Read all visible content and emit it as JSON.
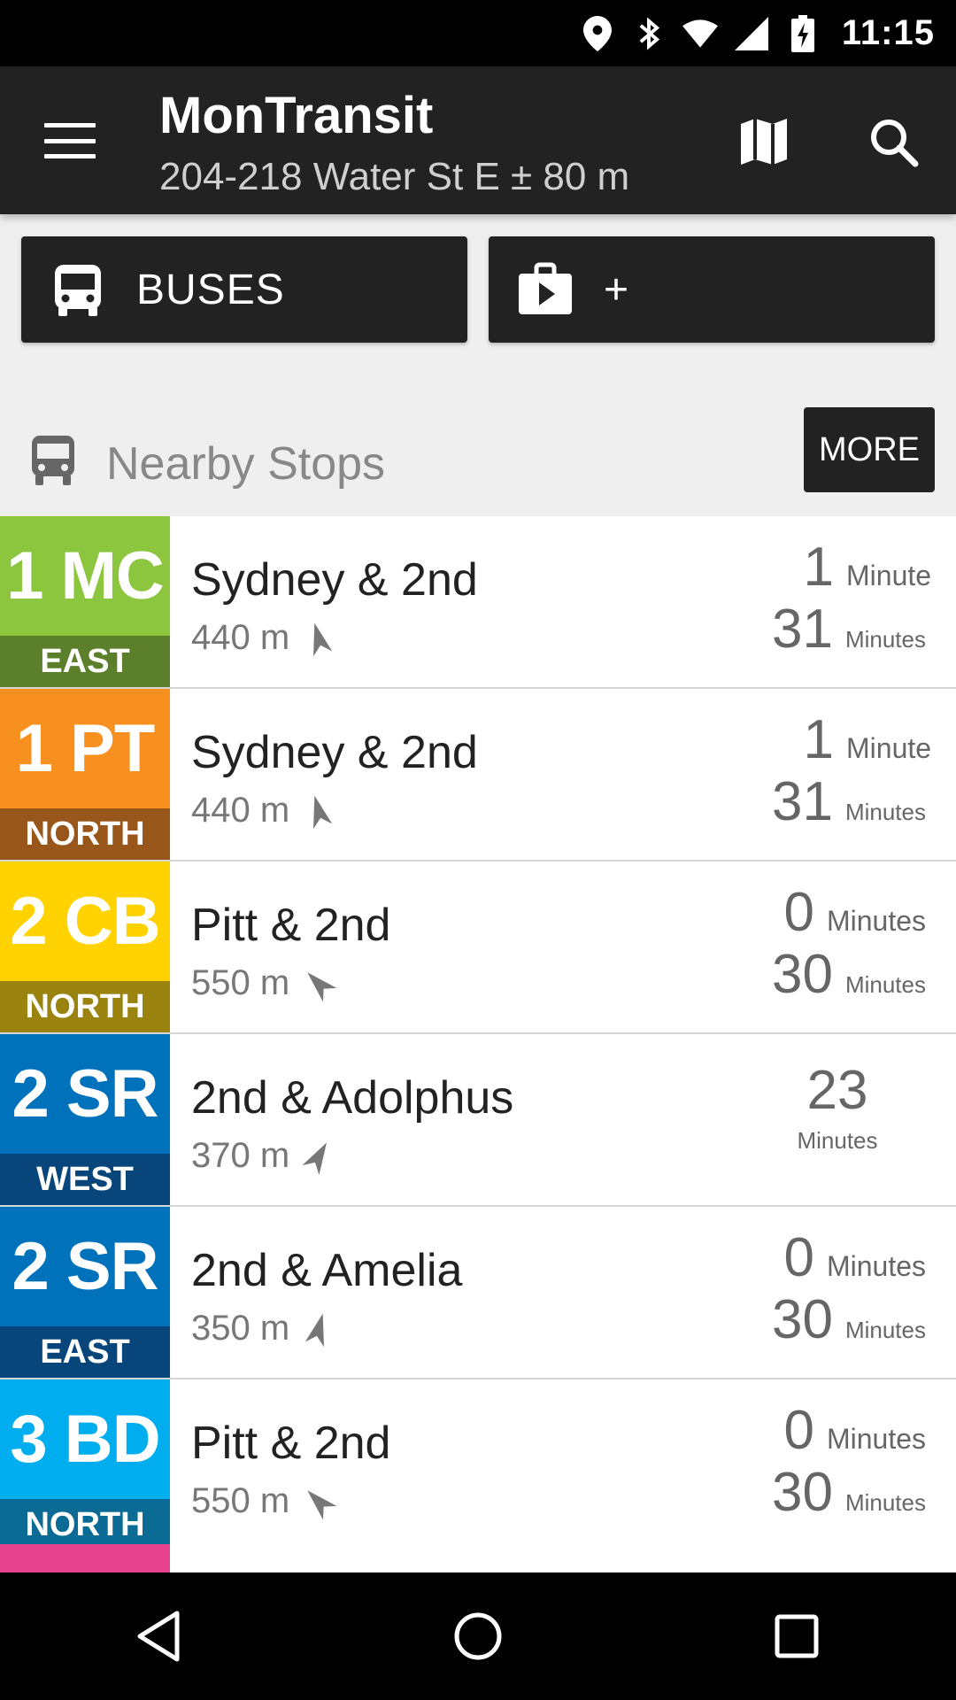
{
  "status": {
    "time": "11:15"
  },
  "appbar": {
    "title": "MonTransit",
    "subtitle": "204-218 Water St E ± 80 m"
  },
  "agencies": [
    {
      "label": "BUSES",
      "icon": "bus-icon"
    },
    {
      "label": "+",
      "icon": "store-icon"
    }
  ],
  "section": {
    "title": "Nearby Stops",
    "more_label": "MORE",
    "icon": "bus-icon"
  },
  "stops": [
    {
      "route": "1 MC",
      "direction": "EAST",
      "name": "Sydney & 2nd",
      "distance": "440 m",
      "color": "#8cc63f",
      "dir_color": "#5b7f2a",
      "time1": "1",
      "unit1": "Minute",
      "time2": "31",
      "unit2": "Minutes"
    },
    {
      "route": "1 PT",
      "direction": "NORTH",
      "name": "Sydney & 2nd",
      "distance": "440 m",
      "color": "#f7901e",
      "dir_color": "#98561b",
      "time1": "1",
      "unit1": "Minute",
      "time2": "31",
      "unit2": "Minutes"
    },
    {
      "route": "2 CB",
      "direction": "NORTH",
      "name": "Pitt & 2nd",
      "distance": "550 m",
      "color": "#ffd200",
      "dir_color": "#9a830f",
      "time1": "0",
      "unit1": "Minutes",
      "time2": "30",
      "unit2": "Minutes"
    },
    {
      "route": "2 SR",
      "direction": "WEST",
      "name": "2nd & Adolphus",
      "distance": "370 m",
      "color": "#0072bc",
      "dir_color": "#07457a",
      "time_single": "23",
      "unit_single": "Minutes"
    },
    {
      "route": "2 SR",
      "direction": "EAST",
      "name": "2nd & Amelia",
      "distance": "350 m",
      "color": "#0072bc",
      "dir_color": "#07457a",
      "time1": "0",
      "unit1": "Minutes",
      "time2": "30",
      "unit2": "Minutes"
    },
    {
      "route": "3 BD",
      "direction": "NORTH",
      "name": "Pitt & 2nd",
      "distance": "550 m",
      "color": "#00aeef",
      "dir_color": "#0b6b94",
      "time1": "0",
      "unit1": "Minutes",
      "time2": "30",
      "unit2": "Minutes"
    }
  ]
}
